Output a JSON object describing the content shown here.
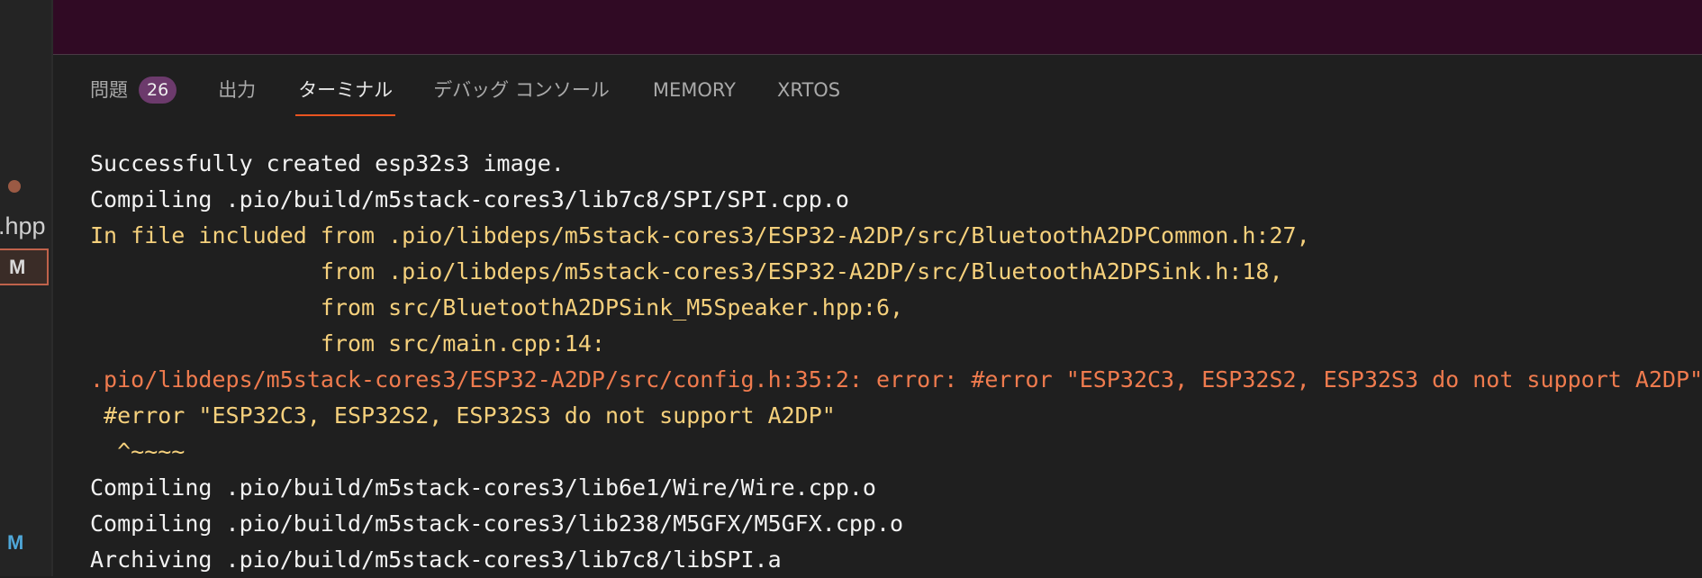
{
  "sidebar": {
    "file_fragment": ".hpp",
    "badge": "M",
    "status_letter": "M"
  },
  "panel": {
    "tabs": [
      {
        "label": "問題",
        "count": "26"
      },
      {
        "label": "出力"
      },
      {
        "label": "ターミナル",
        "active": true
      },
      {
        "label": "デバッグ コンソール"
      },
      {
        "label": "MEMORY"
      },
      {
        "label": "XRTOS"
      }
    ]
  },
  "colors": {
    "accent": "#e95420",
    "top_band": "#300a24",
    "warning_text": "#f5d07c",
    "error_text": "#ef7b4e"
  },
  "terminal": {
    "lines": [
      {
        "text": "Successfully created esp32s3 image.",
        "style": "normal"
      },
      {
        "text": "Compiling .pio/build/m5stack-cores3/lib7c8/SPI/SPI.cpp.o",
        "style": "normal"
      },
      {
        "text": "In file included from .pio/libdeps/m5stack-cores3/ESP32-A2DP/src/BluetoothA2DPCommon.h:27,",
        "style": "warning"
      },
      {
        "text": "                 from .pio/libdeps/m5stack-cores3/ESP32-A2DP/src/BluetoothA2DPSink.h:18,",
        "style": "warning"
      },
      {
        "text": "                 from src/BluetoothA2DPSink_M5Speaker.hpp:6,",
        "style": "warning"
      },
      {
        "text": "                 from src/main.cpp:14:",
        "style": "warning"
      },
      {
        "text": ".pio/libdeps/m5stack-cores3/ESP32-A2DP/src/config.h:35:2: error: #error \"ESP32C3, ESP32S2, ESP32S3 do not support A2DP\"",
        "style": "error"
      },
      {
        "text": " #error \"ESP32C3, ESP32S2, ESP32S3 do not support A2DP\"",
        "style": "warning"
      },
      {
        "text": "  ^~~~~",
        "style": "warning"
      },
      {
        "text": "Compiling .pio/build/m5stack-cores3/lib6e1/Wire/Wire.cpp.o",
        "style": "normal"
      },
      {
        "text": "Compiling .pio/build/m5stack-cores3/lib238/M5GFX/M5GFX.cpp.o",
        "style": "normal"
      },
      {
        "text": "Archiving .pio/build/m5stack-cores3/lib7c8/libSPI.a",
        "style": "normal"
      }
    ]
  }
}
